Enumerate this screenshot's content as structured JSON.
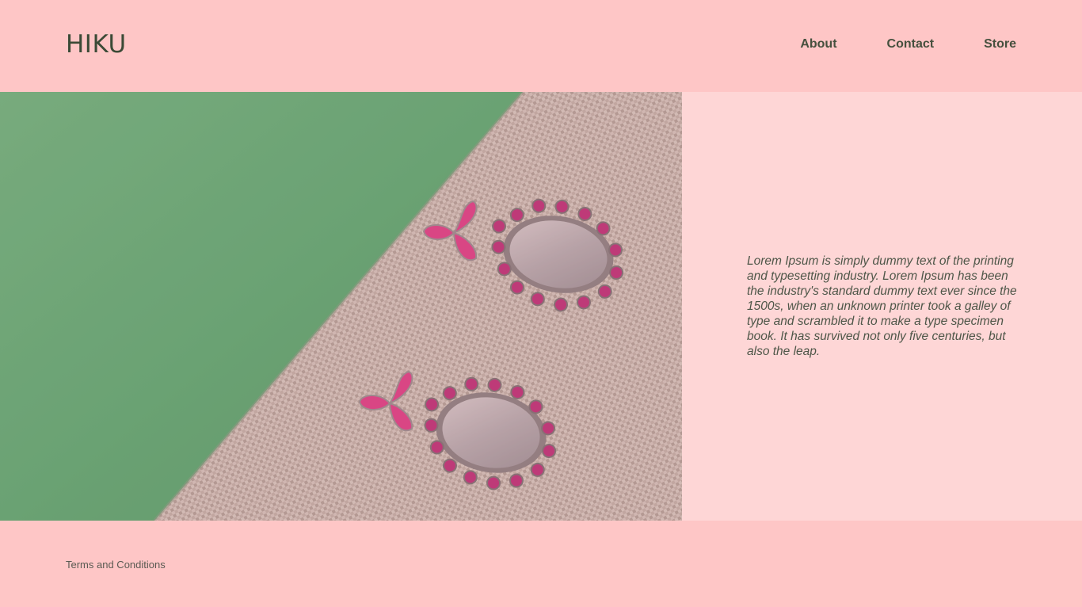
{
  "header": {
    "logo": "HIKU",
    "nav": [
      {
        "label": "About"
      },
      {
        "label": "Contact"
      },
      {
        "label": "Store"
      }
    ]
  },
  "hero": {
    "image": "earrings-on-fabric",
    "body_text": "Lorem Ipsum is simply dummy text of the printing and typesetting industry. Lorem Ipsum has been the industry's standard dummy text ever since the 1500s, when an unknown printer took a galley of type and scrambled it to make a type specimen book. It has survived not only five centuries, but also the leap."
  },
  "footer": {
    "terms_label": "Terms and Conditions"
  },
  "colors": {
    "background": "#fec6c6",
    "panel": "#fed6d6",
    "text": "#3f4a39",
    "fabric_green": "#4f9a63",
    "burlap": "#b8a29b",
    "gem": "#c81f6e"
  }
}
